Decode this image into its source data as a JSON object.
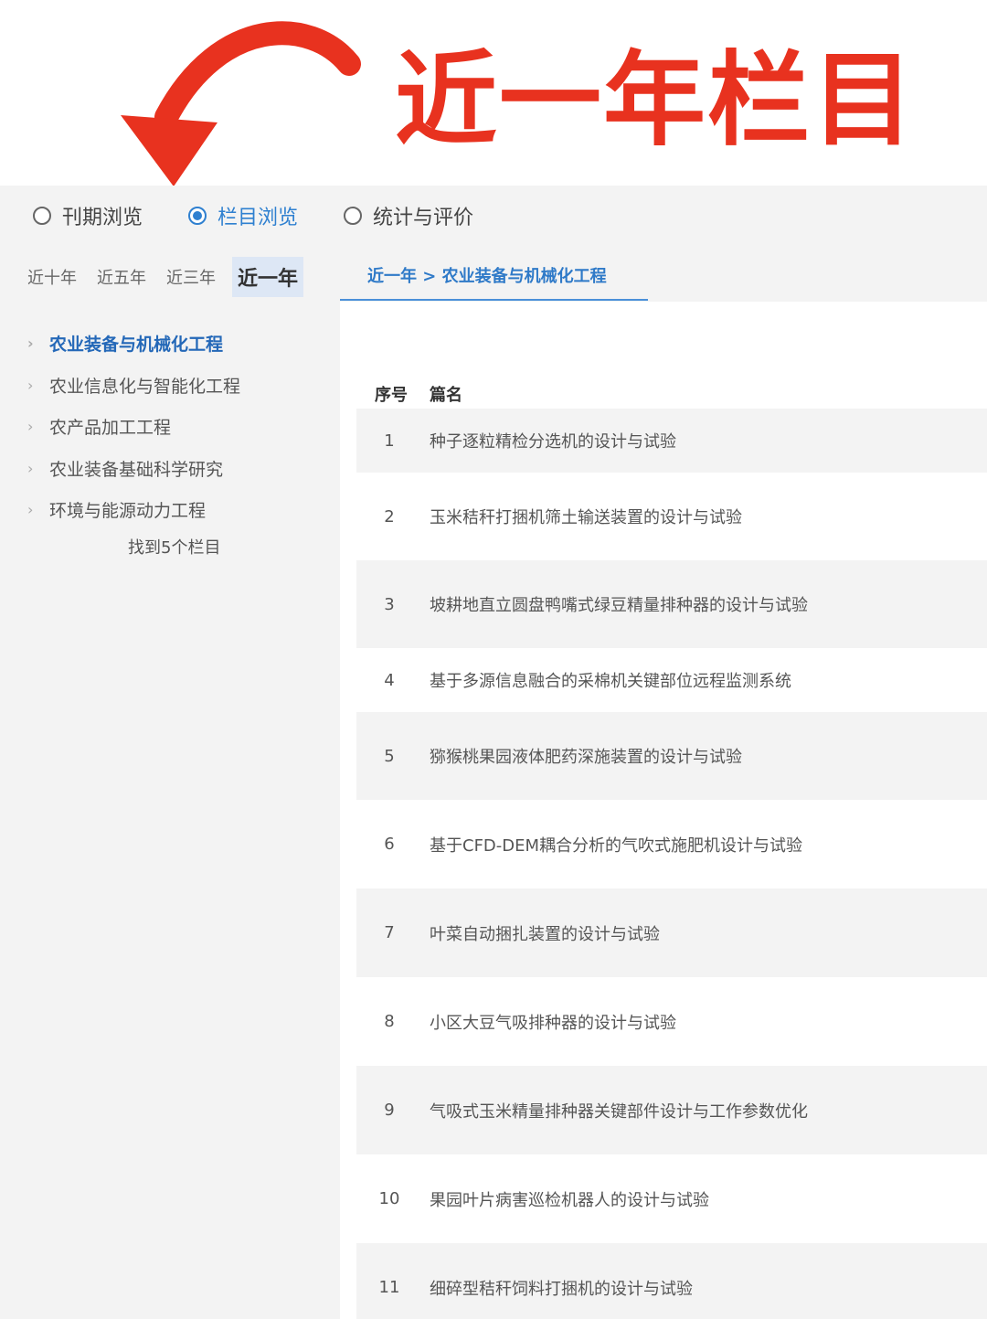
{
  "annotation": {
    "title": "近一年栏目",
    "arrow_color": "#e8321f"
  },
  "browse_modes": [
    {
      "label": "刊期浏览",
      "selected": false
    },
    {
      "label": "栏目浏览",
      "selected": true
    },
    {
      "label": "统计与评价",
      "selected": false
    }
  ],
  "year_tabs": [
    {
      "label": "近十年",
      "active": false
    },
    {
      "label": "近五年",
      "active": false
    },
    {
      "label": "近三年",
      "active": false
    },
    {
      "label": "近一年",
      "active": true
    }
  ],
  "breadcrumb": "近一年 > 农业装备与机械化工程",
  "categories": [
    {
      "label": "农业装备与机械化工程",
      "active": true
    },
    {
      "label": "农业信息化与智能化工程",
      "active": false
    },
    {
      "label": "农产品加工工程",
      "active": false
    },
    {
      "label": "农业装备基础科学研究",
      "active": false
    },
    {
      "label": "环境与能源动力工程",
      "active": false
    }
  ],
  "found_text": "找到5个栏目",
  "table": {
    "headers": {
      "index": "序号",
      "title": "篇名"
    },
    "rows": [
      {
        "no": "1",
        "title": "种子逐粒精检分选机的设计与试验"
      },
      {
        "no": "2",
        "title": "玉米秸秆打捆机筛土输送装置的设计与试验"
      },
      {
        "no": "3",
        "title": "坡耕地直立圆盘鸭嘴式绿豆精量排种器的设计与试验"
      },
      {
        "no": "4",
        "title": "基于多源信息融合的采棉机关键部位远程监测系统"
      },
      {
        "no": "5",
        "title": "猕猴桃果园液体肥药深施装置的设计与试验"
      },
      {
        "no": "6",
        "title": "基于CFD-DEM耦合分析的气吹式施肥机设计与试验"
      },
      {
        "no": "7",
        "title": "叶菜自动捆扎装置的设计与试验"
      },
      {
        "no": "8",
        "title": "小区大豆气吸排种器的设计与试验"
      },
      {
        "no": "9",
        "title": "气吸式玉米精量排种器关键部件设计与工作参数优化"
      },
      {
        "no": "10",
        "title": "果园叶片病害巡检机器人的设计与试验"
      },
      {
        "no": "11",
        "title": "细碎型秸秆饲料打捆机的设计与试验"
      }
    ]
  }
}
